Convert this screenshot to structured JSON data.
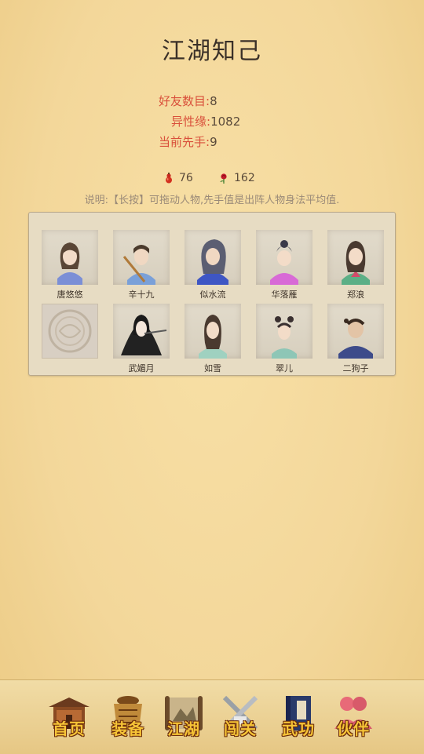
{
  "page_title": "江湖知己",
  "stats": [
    {
      "label": "好友数目:",
      "value": "8"
    },
    {
      "label": "异性缘:",
      "value": "1082"
    },
    {
      "label": "当前先手:",
      "value": "9"
    }
  ],
  "resources": {
    "gourd": {
      "icon": "gourd-icon",
      "value": "76"
    },
    "rose": {
      "icon": "rose-icon",
      "value": "162"
    }
  },
  "hint": "说明:【长按】可拖动人物,先手值是出阵人物身法平均值.",
  "characters": [
    {
      "name": "唐悠悠",
      "icon": "female-portrait",
      "color": "#7b8fd6"
    },
    {
      "name": "辛十九",
      "icon": "male-portrait",
      "color": "#7aa0d8"
    },
    {
      "name": "似水流",
      "icon": "male-portrait",
      "color": "#3e56c4"
    },
    {
      "name": "华落雁",
      "icon": "female-portrait",
      "color": "#d86ad6"
    },
    {
      "name": "郑浪",
      "icon": "female-portrait",
      "color": "#5caf86"
    },
    {
      "name": "武媚月",
      "icon": "female-portrait",
      "color": "#222222"
    },
    {
      "name": "如雪",
      "icon": "female-portrait",
      "color": "#9fd1c0"
    },
    {
      "name": "翠儿",
      "icon": "female-portrait",
      "color": "#8ec6b6"
    },
    {
      "name": "二狗子",
      "icon": "male-portrait",
      "color": "#3d4b8a"
    }
  ],
  "empty_slot": {
    "icon": "empty-slot-emblem"
  },
  "nav": [
    {
      "label": "首页",
      "icon": "temple-icon",
      "active": false
    },
    {
      "label": "装备",
      "icon": "armor-icon",
      "active": false
    },
    {
      "label": "江湖",
      "icon": "scroll-map-icon",
      "active": false
    },
    {
      "label": "闯关",
      "icon": "crossed-swords-icon",
      "active": false
    },
    {
      "label": "武功",
      "icon": "book-icon",
      "active": false
    },
    {
      "label": "伙伴",
      "icon": "partners-icon",
      "active": true
    }
  ],
  "colors": {
    "label_red": "#d9503b",
    "nav_gold": "#f6c437",
    "panel_bg": "#e7dcc3"
  }
}
